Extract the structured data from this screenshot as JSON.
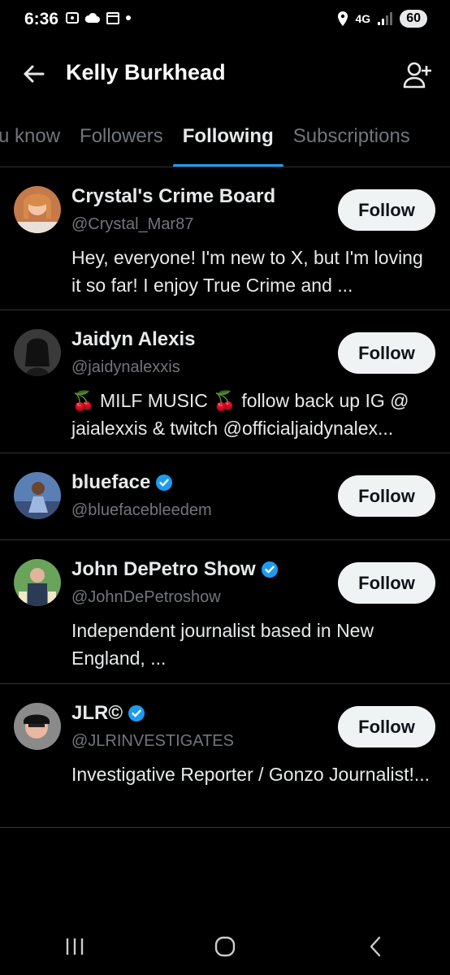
{
  "status_bar": {
    "time": "6:36",
    "network": "4G",
    "battery": "60"
  },
  "header": {
    "title": "Kelly Burkhead"
  },
  "tabs": [
    {
      "label": "u know"
    },
    {
      "label": "Followers"
    },
    {
      "label": "Following"
    },
    {
      "label": "Subscriptions"
    }
  ],
  "active_tab": "Following",
  "accent_color": "#1d9bf0",
  "accounts": [
    {
      "name": "Crystal's Crime Board",
      "handle": "@Crystal_Mar87",
      "verified": false,
      "bio": "Hey, everyone! I'm new to X, but I'm loving it so far! I enjoy True Crime and ...",
      "button": "Follow"
    },
    {
      "name": "Jaidyn Alexis",
      "handle": "@jaidynalexxis",
      "verified": false,
      "bio": "🍒 MILF MUSIC 🍒 follow back up IG @ jaialexxis & twitch @officialjaidynalex...",
      "button": "Follow"
    },
    {
      "name": "blueface",
      "handle": "@bluefacebleedem",
      "verified": true,
      "bio": "",
      "button": "Follow"
    },
    {
      "name": "John DePetro Show",
      "handle": "@JohnDePetroshow",
      "verified": true,
      "bio": "Independent journalist based in New England, ...",
      "button": "Follow"
    },
    {
      "name": "JLR©",
      "handle": "@JLRINVESTIGATES",
      "verified": true,
      "bio": "Investigative Reporter / Gonzo Journalist!...",
      "button": "Follow"
    }
  ]
}
